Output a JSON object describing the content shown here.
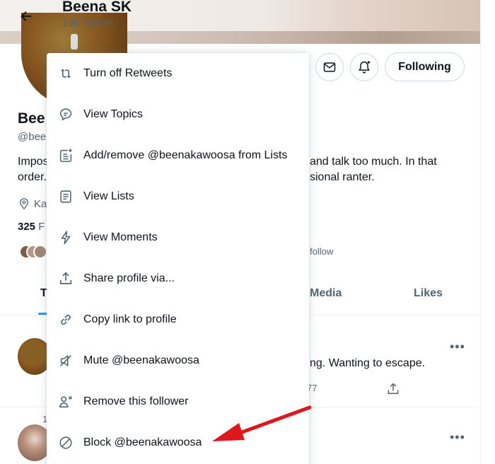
{
  "header": {
    "name": "Beena SK",
    "tweet_count": "19K Tweets"
  },
  "profile": {
    "name_fragment": "Bee",
    "handle_fragment": "@bee",
    "bio_left_line1": "Impos",
    "bio_left_line2": "order.",
    "bio_right_line1": "and talk too much. In that",
    "bio_right_line2": "sional ranter.",
    "location_fragment": "Ka",
    "following_count": "325",
    "following_fragment": "F",
    "followed_by_fragment": "follow"
  },
  "actions": {
    "following_label": "Following"
  },
  "tabs": {
    "active_fragment": "T",
    "media": "Media",
    "likes": "Likes"
  },
  "tweets": [
    {
      "text_fragment": "ng. Wanting to escape.",
      "stat_fragment": "77",
      "more": "•••"
    },
    {
      "tick_fragment": "1",
      "more": "•••"
    }
  ],
  "menu": {
    "items": [
      {
        "label": "Turn off Retweets",
        "icon": "retweet-icon"
      },
      {
        "label": "View Topics",
        "icon": "topics-icon"
      },
      {
        "label": "Add/remove @beenakawoosa from Lists",
        "icon": "list-add-icon"
      },
      {
        "label": "View Lists",
        "icon": "lists-icon"
      },
      {
        "label": "View Moments",
        "icon": "lightning-icon"
      },
      {
        "label": "Share profile via...",
        "icon": "share-icon"
      },
      {
        "label": "Copy link to profile",
        "icon": "link-icon"
      },
      {
        "label": "Mute @beenakawoosa",
        "icon": "mute-icon"
      },
      {
        "label": "Remove this follower",
        "icon": "remove-user-icon"
      },
      {
        "label": "Block @beenakawoosa",
        "icon": "block-icon"
      }
    ]
  },
  "colors": {
    "accent": "#1d9bf0",
    "annotation_arrow": "#e0161d",
    "text_primary": "#0f1419",
    "text_secondary": "#536471"
  }
}
